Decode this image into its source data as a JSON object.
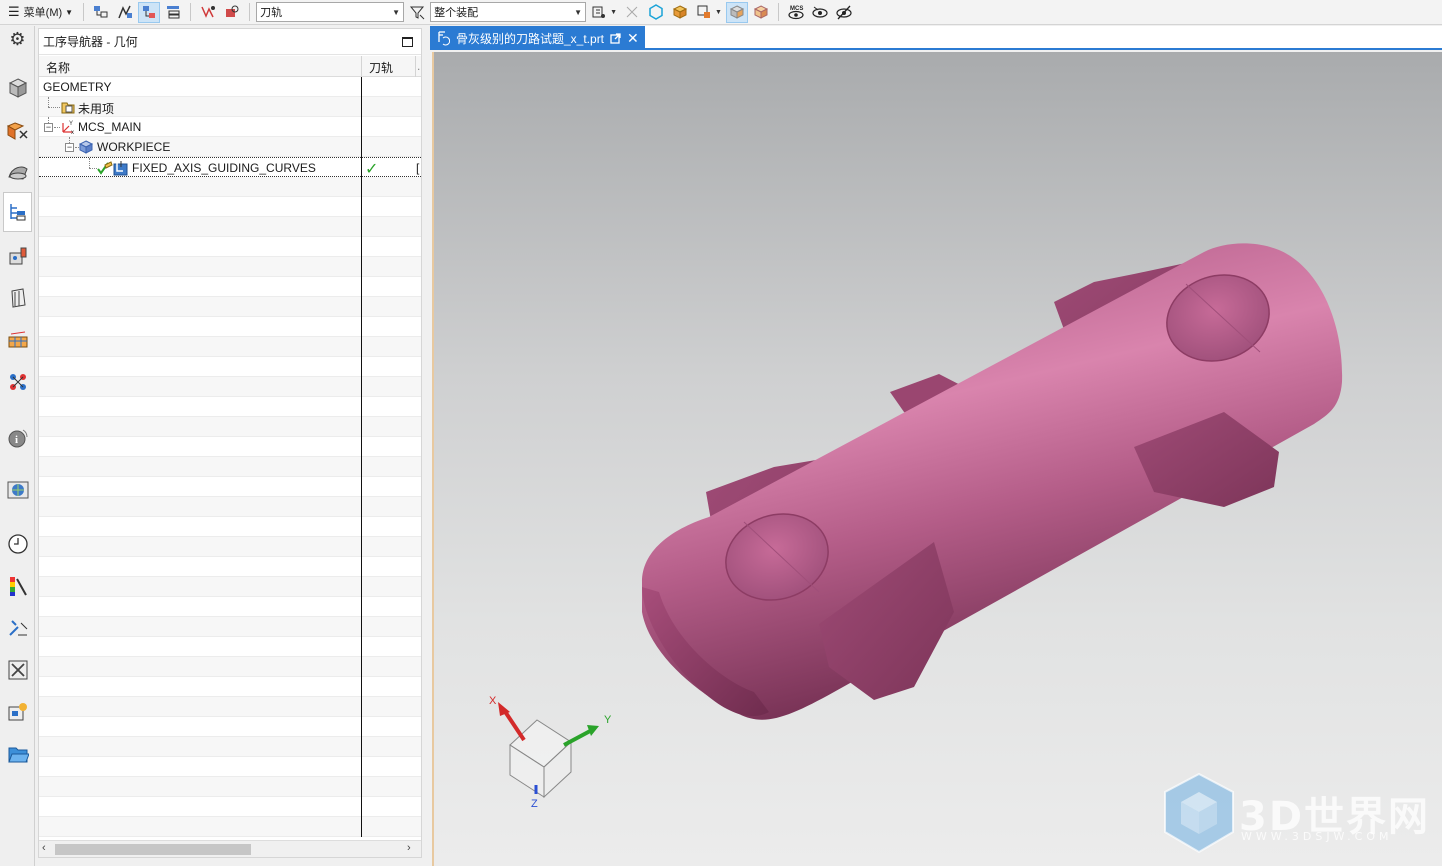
{
  "toolbar": {
    "menu_label": "菜单(M)",
    "filter_type_value": "刀轨",
    "filter_scope_value": "整个装配",
    "mcs_label": "MCS"
  },
  "navigator": {
    "title": "工序导航器 - 几何",
    "columns": {
      "name": "名称",
      "toolpath": "刀轨"
    },
    "tree": [
      {
        "label": "GEOMETRY",
        "level": 0,
        "icon": "none"
      },
      {
        "label": "未用项",
        "level": 1,
        "icon": "folder-icon"
      },
      {
        "label": "MCS_MAIN",
        "level": 1,
        "icon": "mcs-icon",
        "expanded": true
      },
      {
        "label": "WORKPIECE",
        "level": 2,
        "icon": "workpiece-icon",
        "expanded": true
      },
      {
        "label": "FIXED_AXIS_GUIDING_CURVES",
        "level": 3,
        "icon": "operation-icon",
        "toolpath_status": "✓",
        "extra": "[",
        "selected": true
      }
    ]
  },
  "graphics": {
    "tab_title": "骨灰级别的刀路试题_x_t.prt",
    "triad": {
      "x": "X",
      "y": "Y",
      "z": "Z"
    },
    "part_color": "#b05a85"
  },
  "watermark": {
    "brand": "3D世界网",
    "url": "WWW.3DSJW.COM"
  },
  "colors": {
    "accent": "#2b7bd3",
    "check_green": "#2aa32a"
  }
}
